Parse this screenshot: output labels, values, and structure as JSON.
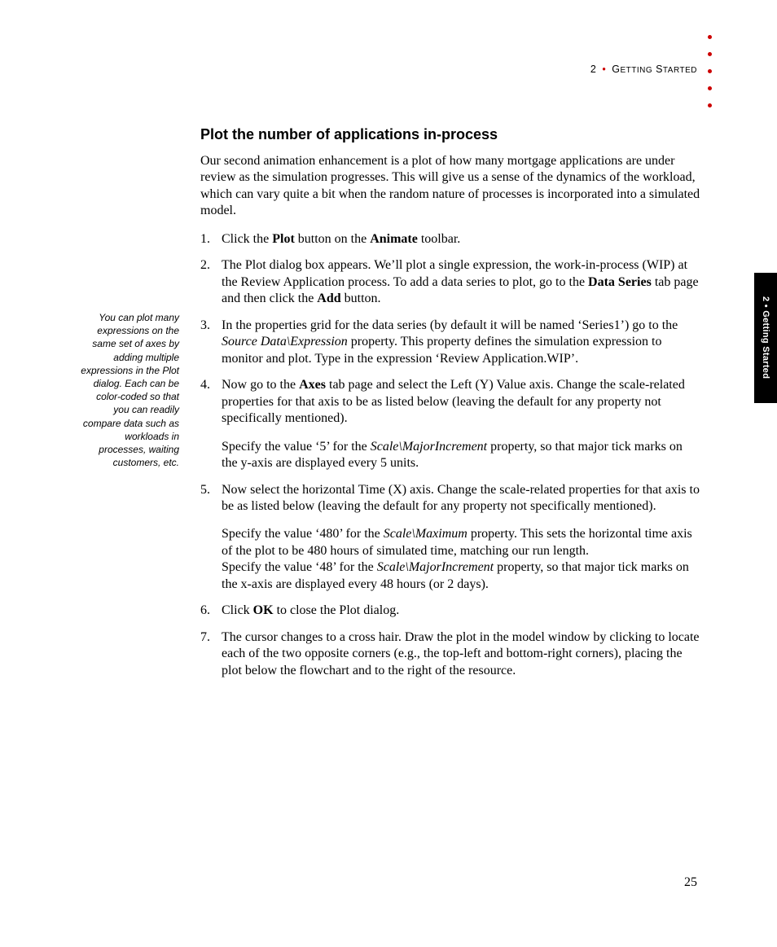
{
  "header": {
    "chapter_num": "2",
    "separator": "•",
    "chapter_title": "Getting Started"
  },
  "thumb_tab": "2 • Getting Started",
  "section_heading": "Plot the number of applications in-process",
  "intro": "Our second animation enhancement is a plot of how many mortgage applications are under review as the simulation progresses. This will give us a sense of the dynamics of the workload, which can vary quite a bit when the random nature of processes is incorporated into a simulated model.",
  "steps": {
    "s1_a": "Click the ",
    "s1_b": "Plot",
    "s1_c": " button on the ",
    "s1_d": "Animate",
    "s1_e": " toolbar.",
    "s2_a": "The Plot dialog box appears. We’ll plot a single expression, the work-in-process (WIP) at the Review Application process. To add a data series to plot, go to the ",
    "s2_b": "Data Series",
    "s2_c": " tab page and then click the ",
    "s2_d": "Add",
    "s2_e": " button.",
    "s3_a": "In the properties grid for the data series (by default it will be named ‘Series1’) go to the ",
    "s3_b": "Source Data\\Expression",
    "s3_c": " property. This property defines the simulation expression to monitor and plot. Type in the expression ‘Review Application.WIP’.",
    "s4_a": "Now go to the ",
    "s4_b": "Axes",
    "s4_c": " tab page and select the Left (Y) Value axis. Change the scale-related properties for that axis to be as listed below (leaving the default for any property not specifically mentioned).",
    "s4_sub1_a": "Specify the value ‘5’ for the ",
    "s4_sub1_b": "Scale\\MajorIncrement",
    "s4_sub1_c": " property, so that major tick marks on the y-axis are displayed every 5 units.",
    "s5_a": "Now select the horizontal Time (X) axis. Change the scale-related properties for that axis to be as listed below (leaving the default for any property not specifically mentioned).",
    "s5_sub1_a": "Specify the value ‘480’ for the ",
    "s5_sub1_b": "Scale\\Maximum",
    "s5_sub1_c": " property. This sets the horizontal time axis of the plot to be 480 hours of simulated time, matching our run length.",
    "s5_sub2_a": "Specify the value ‘48’ for the ",
    "s5_sub2_b": "Scale\\MajorIncrement",
    "s5_sub2_c": " property, so that major tick marks on the x-axis are displayed every 48 hours (or 2 days).",
    "s6_a": "Click ",
    "s6_b": "OK",
    "s6_c": " to close the Plot dialog.",
    "s7": "The cursor changes to a cross hair. Draw the plot in the model window by clicking to locate each of the two opposite corners (e.g., the top-left and bottom-right corners), placing the plot below the flowchart and to the right of the resource."
  },
  "sidenote": "You can plot many expressions on the same set of axes by adding multiple expressions in the Plot dialog. Each can be color-coded so that you can readily compare data such as workloads in processes, waiting customers, etc.",
  "page_number": "25"
}
